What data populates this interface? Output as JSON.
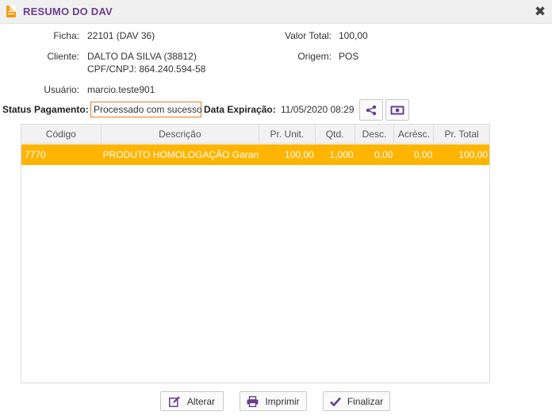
{
  "window": {
    "title": "RESUMO DO DAV",
    "close": "✖"
  },
  "info": {
    "ficha_label": "Ficha:",
    "ficha_value": "22101 (DAV 36)",
    "valor_total_label": "Valor Total:",
    "valor_total_value": "100,00",
    "cliente_label": "Cliente:",
    "cliente_value": "DALTO DA SILVA (38812)",
    "cpf_value": "CPF/CNPJ: 864.240.594-58",
    "origem_label": "Origem:",
    "origem_value": "POS",
    "usuario_label": "Usuário:",
    "usuario_value": "marcio.teste901"
  },
  "status": {
    "pagamento_label": "Status Pagamento:",
    "pagamento_value": "Processado com sucesso",
    "expiracao_label": "Data Expiração:",
    "expiracao_value": "11/05/2020 08:29"
  },
  "grid": {
    "columns": [
      "Código",
      "Descrição",
      "Pr. Unit.",
      "Qtd.",
      "Desc.",
      "Acrésc.",
      "Pr. Total"
    ],
    "rows": [
      {
        "codigo": "7770",
        "descricao": "PRODUTO HOMOLOGAÇÃO Garantia le",
        "pr_unit": "100,00",
        "qtd": "1,000",
        "desc": "0,00",
        "acresc": "0,00",
        "pr_total": "100,00"
      }
    ]
  },
  "footer": {
    "alterar": "Alterar",
    "imprimir": "Imprimir",
    "finalizar": "Finalizar"
  },
  "colors": {
    "accent": "#6a3d8f",
    "selected_row": "#ffb400",
    "status_border": "#e67e22"
  },
  "icons": {
    "title": "document-icon",
    "share": "share-icon",
    "money": "money-icon",
    "edit": "edit-icon",
    "print": "print-icon",
    "check": "check-icon"
  }
}
